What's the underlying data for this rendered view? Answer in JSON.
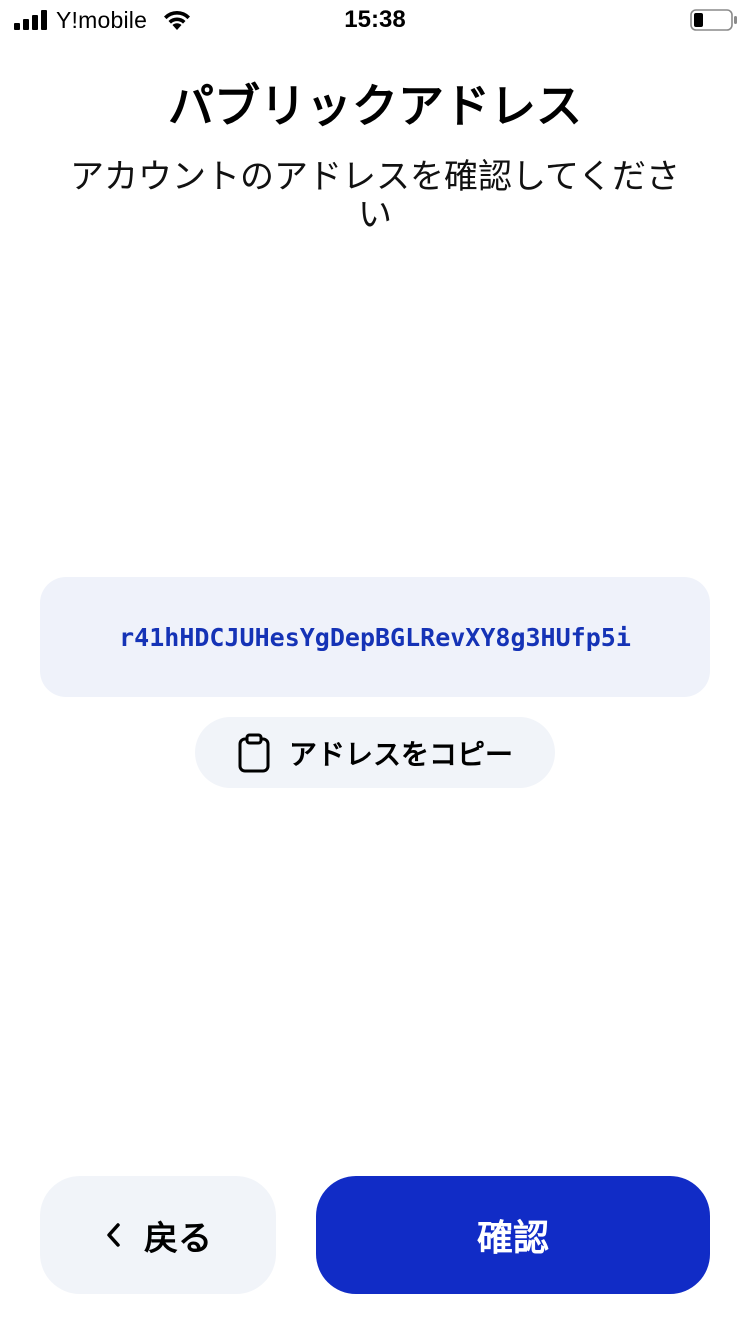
{
  "status_bar": {
    "carrier": "Y!mobile",
    "time": "15:38",
    "icons": [
      "cellular-signal-icon",
      "wifi-icon",
      "battery-icon"
    ]
  },
  "header": {
    "title": "パブリックアドレス",
    "subtitle": "アカウントのアドレスを確認してください"
  },
  "address": {
    "value": "r41hHDCJUHesYgDepBGLRevXY8g3HUfp5i"
  },
  "copy_button": {
    "label": "アドレスをコピー",
    "icon": "clipboard-icon"
  },
  "footer": {
    "back_label": "戻る",
    "back_icon": "chevron-left-icon",
    "confirm_label": "確認"
  },
  "colors": {
    "accent": "#112cc6",
    "address_text": "#1533b6",
    "card_background": "#eff2fa",
    "secondary_button": "#f1f4f9"
  }
}
